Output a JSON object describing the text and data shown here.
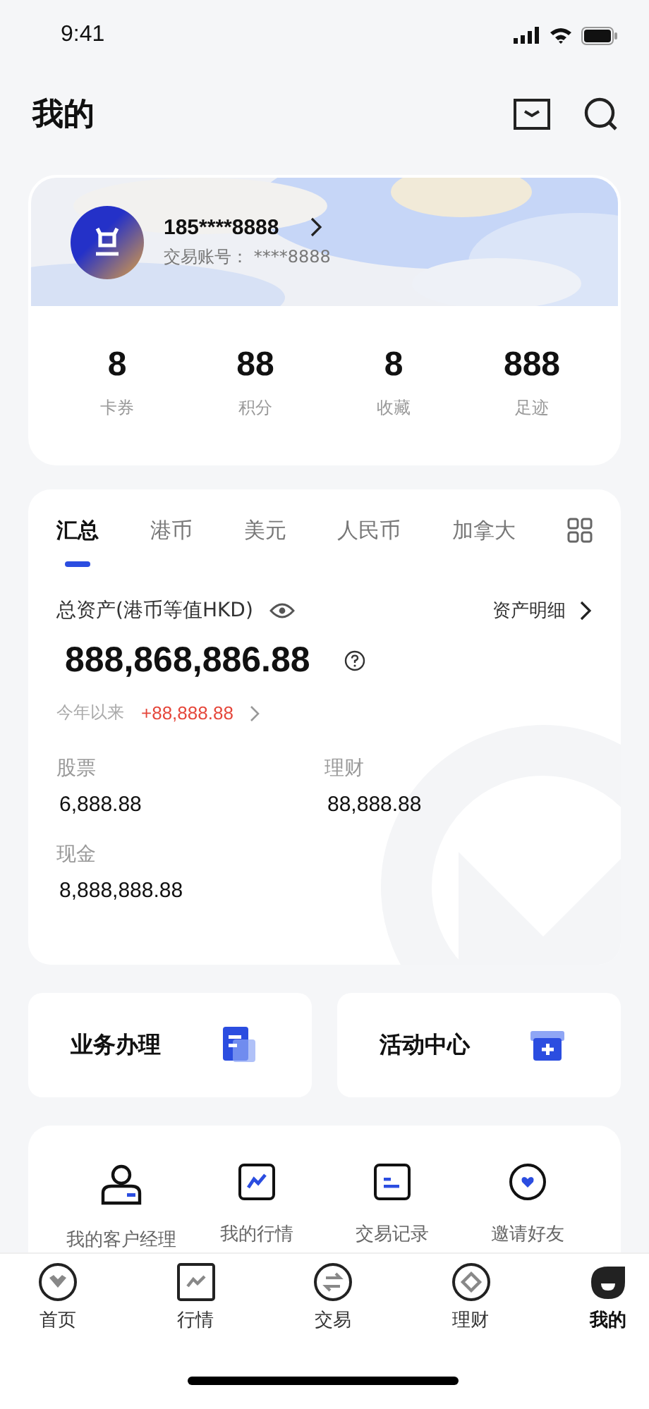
{
  "status_bar": {
    "time": "9:41"
  },
  "header": {
    "title": "我的"
  },
  "profile": {
    "phone": "185****8888",
    "account_label": "交易账号：",
    "account": "****8888"
  },
  "stats": [
    {
      "value": "8",
      "label": "卡券"
    },
    {
      "value": "88",
      "label": "积分"
    },
    {
      "value": "8",
      "label": "收藏"
    },
    {
      "value": "888",
      "label": "足迹"
    }
  ],
  "tabs": [
    {
      "label": "汇总",
      "selected": true
    },
    {
      "label": "港币",
      "selected": false
    },
    {
      "label": "美元",
      "selected": false
    },
    {
      "label": "人民币",
      "selected": false
    },
    {
      "label": "加拿大",
      "selected": false
    }
  ],
  "assets": {
    "title": "总资产(港币等值HKD)",
    "detail_link": "资产明细",
    "total": "888,868,886.88",
    "ytd_label": "今年以来",
    "ytd_value": "+88,888.88",
    "items": [
      {
        "label": "股票",
        "value": "6,888.88"
      },
      {
        "label": "理财",
        "value": "88,888.88"
      },
      {
        "label": "现金",
        "value": "8,888,888.88"
      }
    ]
  },
  "services": [
    {
      "label": "业务办理",
      "kind": "document"
    },
    {
      "label": "活动中心",
      "kind": "gift"
    }
  ],
  "shortcuts": [
    {
      "label": "我的客户经理",
      "kind": "person"
    },
    {
      "label": "我的行情",
      "kind": "chart"
    },
    {
      "label": "交易记录",
      "kind": "record"
    },
    {
      "label": "邀请好友",
      "kind": "heart"
    }
  ],
  "tab_bar": [
    {
      "label": "首页",
      "kind": "home",
      "selected": false
    },
    {
      "label": "行情",
      "kind": "chart",
      "selected": false
    },
    {
      "label": "交易",
      "kind": "trade",
      "selected": false
    },
    {
      "label": "理财",
      "kind": "wealth",
      "selected": false
    },
    {
      "label": "我的",
      "kind": "me",
      "selected": true
    }
  ]
}
